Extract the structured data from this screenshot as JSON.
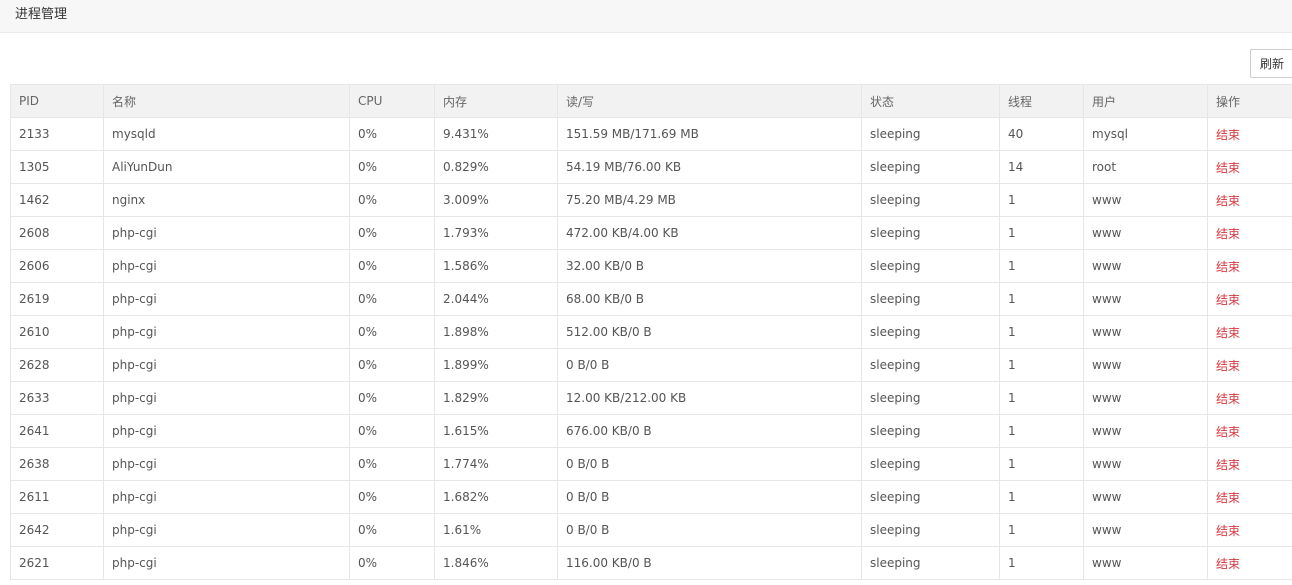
{
  "header": {
    "title": "进程管理"
  },
  "toolbar": {
    "refresh_label": "刷新"
  },
  "table": {
    "columns": [
      "PID",
      "名称",
      "CPU",
      "内存",
      "读/写",
      "状态",
      "线程",
      "用户",
      "操作"
    ],
    "rows": [
      {
        "pid": "2133",
        "name": "mysqld",
        "cpu": "0%",
        "mem": "9.431%",
        "io": "151.59 MB/171.69 MB",
        "state": "sleeping",
        "threads": "40",
        "user": "mysql",
        "action": "结束"
      },
      {
        "pid": "1305",
        "name": "AliYunDun",
        "cpu": "0%",
        "mem": "0.829%",
        "io": "54.19 MB/76.00 KB",
        "state": "sleeping",
        "threads": "14",
        "user": "root",
        "action": "结束"
      },
      {
        "pid": "1462",
        "name": "nginx",
        "cpu": "0%",
        "mem": "3.009%",
        "io": "75.20 MB/4.29 MB",
        "state": "sleeping",
        "threads": "1",
        "user": "www",
        "action": "结束"
      },
      {
        "pid": "2608",
        "name": "php-cgi",
        "cpu": "0%",
        "mem": "1.793%",
        "io": "472.00 KB/4.00 KB",
        "state": "sleeping",
        "threads": "1",
        "user": "www",
        "action": "结束"
      },
      {
        "pid": "2606",
        "name": "php-cgi",
        "cpu": "0%",
        "mem": "1.586%",
        "io": "32.00 KB/0 B",
        "state": "sleeping",
        "threads": "1",
        "user": "www",
        "action": "结束"
      },
      {
        "pid": "2619",
        "name": "php-cgi",
        "cpu": "0%",
        "mem": "2.044%",
        "io": "68.00 KB/0 B",
        "state": "sleeping",
        "threads": "1",
        "user": "www",
        "action": "结束"
      },
      {
        "pid": "2610",
        "name": "php-cgi",
        "cpu": "0%",
        "mem": "1.898%",
        "io": "512.00 KB/0 B",
        "state": "sleeping",
        "threads": "1",
        "user": "www",
        "action": "结束"
      },
      {
        "pid": "2628",
        "name": "php-cgi",
        "cpu": "0%",
        "mem": "1.899%",
        "io": "0 B/0 B",
        "state": "sleeping",
        "threads": "1",
        "user": "www",
        "action": "结束"
      },
      {
        "pid": "2633",
        "name": "php-cgi",
        "cpu": "0%",
        "mem": "1.829%",
        "io": "12.00 KB/212.00 KB",
        "state": "sleeping",
        "threads": "1",
        "user": "www",
        "action": "结束"
      },
      {
        "pid": "2641",
        "name": "php-cgi",
        "cpu": "0%",
        "mem": "1.615%",
        "io": "676.00 KB/0 B",
        "state": "sleeping",
        "threads": "1",
        "user": "www",
        "action": "结束"
      },
      {
        "pid": "2638",
        "name": "php-cgi",
        "cpu": "0%",
        "mem": "1.774%",
        "io": "0 B/0 B",
        "state": "sleeping",
        "threads": "1",
        "user": "www",
        "action": "结束"
      },
      {
        "pid": "2611",
        "name": "php-cgi",
        "cpu": "0%",
        "mem": "1.682%",
        "io": "0 B/0 B",
        "state": "sleeping",
        "threads": "1",
        "user": "www",
        "action": "结束"
      },
      {
        "pid": "2642",
        "name": "php-cgi",
        "cpu": "0%",
        "mem": "1.61%",
        "io": "0 B/0 B",
        "state": "sleeping",
        "threads": "1",
        "user": "www",
        "action": "结束"
      },
      {
        "pid": "2621",
        "name": "php-cgi",
        "cpu": "0%",
        "mem": "1.846%",
        "io": "116.00 KB/0 B",
        "state": "sleeping",
        "threads": "1",
        "user": "www",
        "action": "结束"
      }
    ]
  },
  "colors": {
    "action_link": "#d9363e",
    "header_bg": "#f2f2f2",
    "border": "#e6e6e6"
  }
}
